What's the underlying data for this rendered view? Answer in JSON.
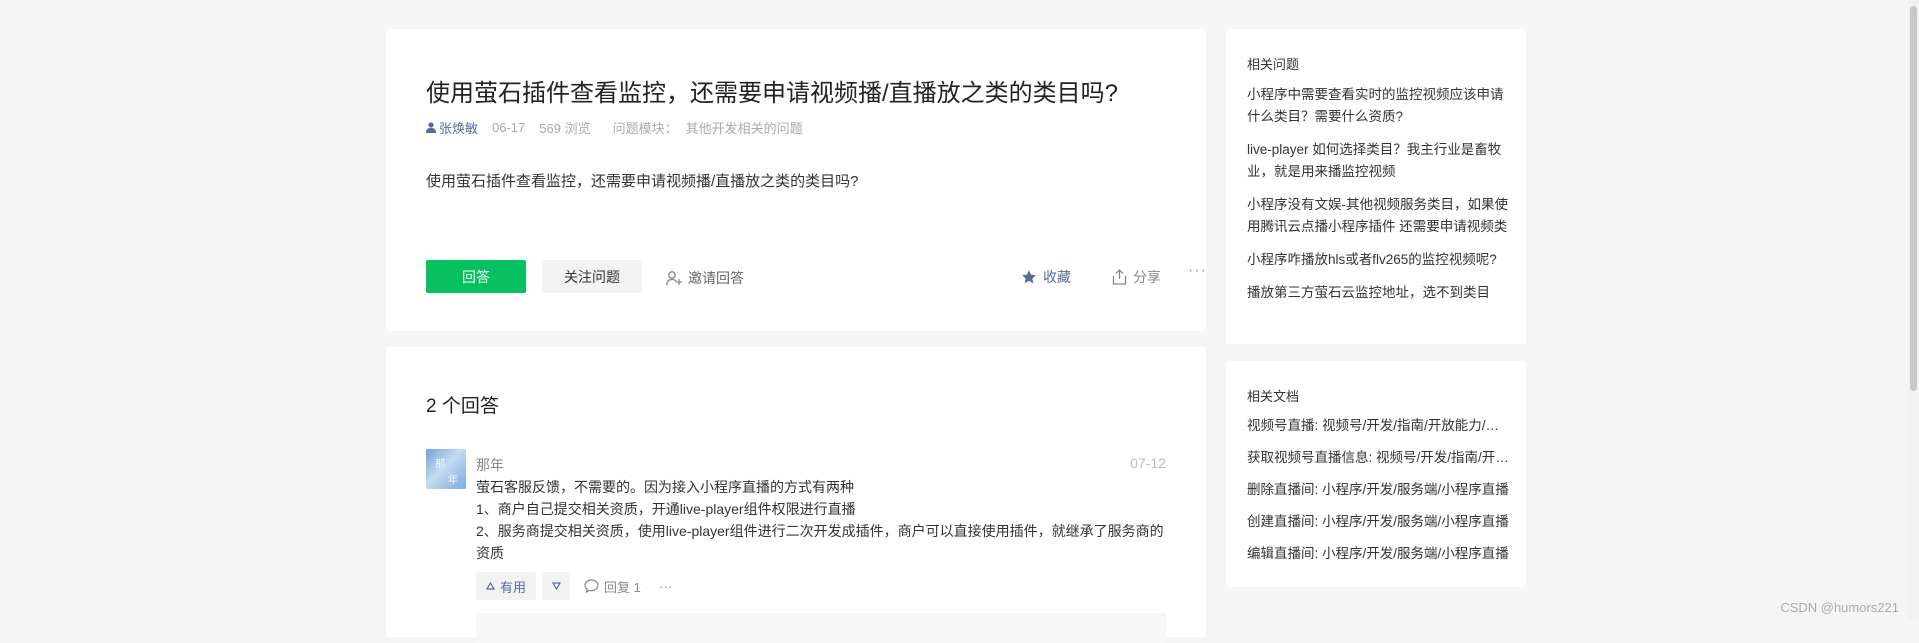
{
  "question": {
    "title": "使用萤石插件查看监控，还需要申请视频播/直播放之类的类目吗?",
    "author": "张焕敏",
    "date": "06-17",
    "views": "569 浏览",
    "module_label": "问题模块：",
    "module_value": "其他开发相关的问题",
    "body": "使用萤石插件查看监控，还需要申请视频播/直播放之类的类目吗?",
    "actions": {
      "answer": "回答",
      "follow": "关注问题",
      "invite": "邀请回答",
      "favorite": "收藏",
      "share": "分享",
      "more": "···"
    }
  },
  "answers": {
    "heading": "2 个回答",
    "items": [
      {
        "name": "那年",
        "date": "07-12",
        "lines": [
          "萤石客服反馈，不需要的。因为接入小程序直播的方式有两种",
          "1、商户自己提交相关资质，开通live-player组件权限进行直播",
          "2、服务商提交相关资质，使用live-player组件进行二次开发成插件，商户可以直接使用插件，就继承了服务商的资质"
        ],
        "useful": "有用",
        "reply": "回复 1",
        "more": "···"
      }
    ]
  },
  "related_questions": {
    "title": "相关问题",
    "items": [
      "小程序中需要查看实时的监控视频应该申请什么类目？需要什么资质?",
      "live-player 如何选择类目？我主行业是畜牧业，就是用来播监控视频",
      "小程序没有文娱-其他视频服务类目，如果使用腾讯云点播小程序插件 还需要申请视频类目吗?",
      "小程序咋播放hls或者flv265的监控视频呢?",
      "播放第三方萤石云监控地址，选不到类目"
    ]
  },
  "related_docs": {
    "title": "相关文档",
    "items": [
      "视频号直播: 视频号/开发/指南/开放能力/视频号直播",
      "获取视频号直播信息: 视频号/开发/指南/开放能力",
      "删除直播间: 小程序/开发/服务端/小程序直播",
      "创建直播间: 小程序/开发/服务端/小程序直播",
      "编辑直播间: 小程序/开发/服务端/小程序直播"
    ]
  },
  "watermark": "CSDN @humors221",
  "colors": {
    "accent": "#07c160",
    "link": "#576b95",
    "background": "#f5f5f5"
  }
}
